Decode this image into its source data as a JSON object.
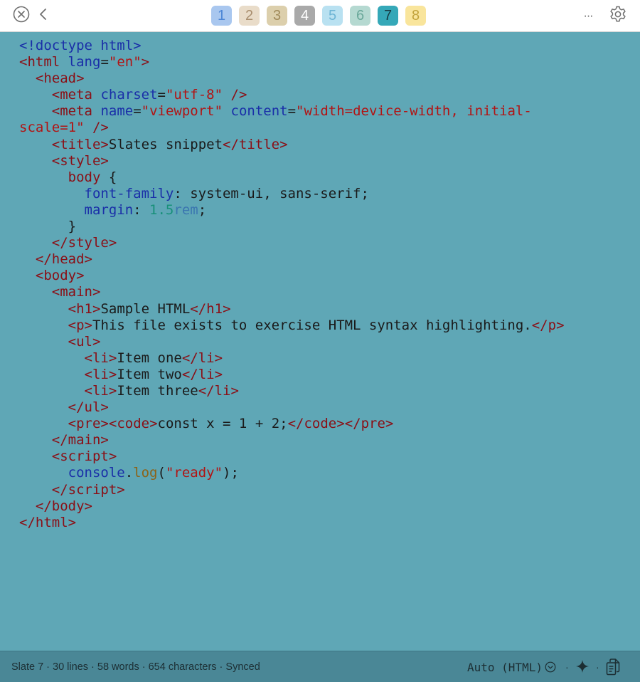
{
  "toolbar": {
    "close_icon": "circle-x-icon",
    "back_icon": "chevron-left-icon",
    "more_label": "···",
    "settings_icon": "gear-icon",
    "tabs": [
      {
        "label": "1",
        "bg": "#a9c7ef",
        "fg": "#4d86d6"
      },
      {
        "label": "2",
        "bg": "#e9dcc9",
        "fg": "#a98e6e"
      },
      {
        "label": "3",
        "bg": "#dccfac",
        "fg": "#a08a5a"
      },
      {
        "label": "4",
        "bg": "#a9a9a9",
        "fg": "#ffffff"
      },
      {
        "label": "5",
        "bg": "#b9e1f1",
        "fg": "#6eb5d5"
      },
      {
        "label": "6",
        "bg": "#b5d9d1",
        "fg": "#6aa89a"
      },
      {
        "label": "7",
        "bg": "#35a8b8",
        "fg": "#173c44"
      },
      {
        "label": "8",
        "bg": "#f9e59c",
        "fg": "#c2a33c"
      }
    ],
    "active_tab": "7"
  },
  "editor": {
    "language": "HTML",
    "lines": [
      [
        {
          "t": "<!doctype html>",
          "c": "dt"
        }
      ],
      [
        {
          "t": "<",
          "c": "tg"
        },
        {
          "t": "html",
          "c": "tg"
        },
        {
          "t": " "
        },
        {
          "t": "lang",
          "c": "at"
        },
        {
          "t": "="
        },
        {
          "t": "\"en\"",
          "c": "st"
        },
        {
          "t": ">",
          "c": "tg"
        }
      ],
      [
        {
          "t": "  "
        },
        {
          "t": "<",
          "c": "tg"
        },
        {
          "t": "head",
          "c": "tg"
        },
        {
          "t": ">",
          "c": "tg"
        }
      ],
      [
        {
          "t": "    "
        },
        {
          "t": "<",
          "c": "tg"
        },
        {
          "t": "meta",
          "c": "tg"
        },
        {
          "t": " "
        },
        {
          "t": "charset",
          "c": "at"
        },
        {
          "t": "="
        },
        {
          "t": "\"utf-8\"",
          "c": "st"
        },
        {
          "t": " "
        },
        {
          "t": "/>",
          "c": "tg"
        }
      ],
      [
        {
          "t": "    "
        },
        {
          "t": "<",
          "c": "tg"
        },
        {
          "t": "meta",
          "c": "tg"
        },
        {
          "t": " "
        },
        {
          "t": "name",
          "c": "at"
        },
        {
          "t": "="
        },
        {
          "t": "\"viewport\"",
          "c": "st"
        },
        {
          "t": " "
        },
        {
          "t": "content",
          "c": "at"
        },
        {
          "t": "="
        },
        {
          "t": "\"width=device-width, initial-",
          "c": "st"
        }
      ],
      [
        {
          "t": "scale=1\"",
          "c": "st"
        },
        {
          "t": " "
        },
        {
          "t": "/>",
          "c": "tg"
        }
      ],
      [
        {
          "t": "    "
        },
        {
          "t": "<",
          "c": "tg"
        },
        {
          "t": "title",
          "c": "tg"
        },
        {
          "t": ">",
          "c": "tg"
        },
        {
          "t": "Slates snippet"
        },
        {
          "t": "</",
          "c": "tg"
        },
        {
          "t": "title",
          "c": "tg"
        },
        {
          "t": ">",
          "c": "tg"
        }
      ],
      [
        {
          "t": "    "
        },
        {
          "t": "<",
          "c": "tg"
        },
        {
          "t": "style",
          "c": "tg"
        },
        {
          "t": ">",
          "c": "tg"
        }
      ],
      [
        {
          "t": "      "
        },
        {
          "t": "body",
          "c": "tg"
        },
        {
          "t": " {"
        }
      ],
      [
        {
          "t": "        "
        },
        {
          "t": "font-family",
          "c": "pr"
        },
        {
          "t": ": system-ui, sans-serif;"
        }
      ],
      [
        {
          "t": "        "
        },
        {
          "t": "margin",
          "c": "pr"
        },
        {
          "t": ": "
        },
        {
          "t": "1.5",
          "c": "nu"
        },
        {
          "t": "rem",
          "c": "un"
        },
        {
          "t": ";"
        }
      ],
      [
        {
          "t": "      }"
        }
      ],
      [
        {
          "t": "    "
        },
        {
          "t": "</",
          "c": "tg"
        },
        {
          "t": "style",
          "c": "tg"
        },
        {
          "t": ">",
          "c": "tg"
        }
      ],
      [
        {
          "t": "  "
        },
        {
          "t": "</",
          "c": "tg"
        },
        {
          "t": "head",
          "c": "tg"
        },
        {
          "t": ">",
          "c": "tg"
        }
      ],
      [
        {
          "t": "  "
        },
        {
          "t": "<",
          "c": "tg"
        },
        {
          "t": "body",
          "c": "tg"
        },
        {
          "t": ">",
          "c": "tg"
        }
      ],
      [
        {
          "t": "    "
        },
        {
          "t": "<",
          "c": "tg"
        },
        {
          "t": "main",
          "c": "tg"
        },
        {
          "t": ">",
          "c": "tg"
        }
      ],
      [
        {
          "t": "      "
        },
        {
          "t": "<",
          "c": "tg"
        },
        {
          "t": "h1",
          "c": "tg"
        },
        {
          "t": ">",
          "c": "tg"
        },
        {
          "t": "Sample HTML"
        },
        {
          "t": "</",
          "c": "tg"
        },
        {
          "t": "h1",
          "c": "tg"
        },
        {
          "t": ">",
          "c": "tg"
        }
      ],
      [
        {
          "t": "      "
        },
        {
          "t": "<",
          "c": "tg"
        },
        {
          "t": "p",
          "c": "tg"
        },
        {
          "t": ">",
          "c": "tg"
        },
        {
          "t": "This file exists to exercise HTML syntax highlighting."
        },
        {
          "t": "</",
          "c": "tg"
        },
        {
          "t": "p",
          "c": "tg"
        },
        {
          "t": ">",
          "c": "tg"
        }
      ],
      [
        {
          "t": "      "
        },
        {
          "t": "<",
          "c": "tg"
        },
        {
          "t": "ul",
          "c": "tg"
        },
        {
          "t": ">",
          "c": "tg"
        }
      ],
      [
        {
          "t": "        "
        },
        {
          "t": "<",
          "c": "tg"
        },
        {
          "t": "li",
          "c": "tg"
        },
        {
          "t": ">",
          "c": "tg"
        },
        {
          "t": "Item one"
        },
        {
          "t": "</",
          "c": "tg"
        },
        {
          "t": "li",
          "c": "tg"
        },
        {
          "t": ">",
          "c": "tg"
        }
      ],
      [
        {
          "t": "        "
        },
        {
          "t": "<",
          "c": "tg"
        },
        {
          "t": "li",
          "c": "tg"
        },
        {
          "t": ">",
          "c": "tg"
        },
        {
          "t": "Item two"
        },
        {
          "t": "</",
          "c": "tg"
        },
        {
          "t": "li",
          "c": "tg"
        },
        {
          "t": ">",
          "c": "tg"
        }
      ],
      [
        {
          "t": "        "
        },
        {
          "t": "<",
          "c": "tg"
        },
        {
          "t": "li",
          "c": "tg"
        },
        {
          "t": ">",
          "c": "tg"
        },
        {
          "t": "Item three"
        },
        {
          "t": "</",
          "c": "tg"
        },
        {
          "t": "li",
          "c": "tg"
        },
        {
          "t": ">",
          "c": "tg"
        }
      ],
      [
        {
          "t": "      "
        },
        {
          "t": "</",
          "c": "tg"
        },
        {
          "t": "ul",
          "c": "tg"
        },
        {
          "t": ">",
          "c": "tg"
        }
      ],
      [
        {
          "t": "      "
        },
        {
          "t": "<",
          "c": "tg"
        },
        {
          "t": "pre",
          "c": "tg"
        },
        {
          "t": ">",
          "c": "tg"
        },
        {
          "t": "<",
          "c": "tg"
        },
        {
          "t": "code",
          "c": "tg"
        },
        {
          "t": ">",
          "c": "tg"
        },
        {
          "t": "const x = 1 + 2;"
        },
        {
          "t": "</",
          "c": "tg"
        },
        {
          "t": "code",
          "c": "tg"
        },
        {
          "t": ">",
          "c": "tg"
        },
        {
          "t": "</",
          "c": "tg"
        },
        {
          "t": "pre",
          "c": "tg"
        },
        {
          "t": ">",
          "c": "tg"
        }
      ],
      [
        {
          "t": "    "
        },
        {
          "t": "</",
          "c": "tg"
        },
        {
          "t": "main",
          "c": "tg"
        },
        {
          "t": ">",
          "c": "tg"
        }
      ],
      [
        {
          "t": "    "
        },
        {
          "t": "<",
          "c": "tg"
        },
        {
          "t": "script",
          "c": "tg"
        },
        {
          "t": ">",
          "c": "tg"
        }
      ],
      [
        {
          "t": "      "
        },
        {
          "t": "console",
          "c": "vr"
        },
        {
          "t": "."
        },
        {
          "t": "log",
          "c": "fn"
        },
        {
          "t": "("
        },
        {
          "t": "\"ready\"",
          "c": "st"
        },
        {
          "t": ");"
        }
      ],
      [
        {
          "t": "    "
        },
        {
          "t": "</",
          "c": "tg"
        },
        {
          "t": "script",
          "c": "tg"
        },
        {
          "t": ">",
          "c": "tg"
        }
      ],
      [
        {
          "t": "  "
        },
        {
          "t": "</",
          "c": "tg"
        },
        {
          "t": "body",
          "c": "tg"
        },
        {
          "t": ">",
          "c": "tg"
        }
      ],
      [
        {
          "t": "</",
          "c": "tg"
        },
        {
          "t": "html",
          "c": "tg"
        },
        {
          "t": ">",
          "c": "tg"
        }
      ]
    ]
  },
  "statusbar": {
    "summary": "Slate 7 · 30 lines · 58 words · 654 characters · Synced",
    "language_mode": "Auto (HTML)",
    "separator": "·",
    "dropdown_icon": "chevron-down-circle-icon",
    "sparkle_icon": "sparkle-icon",
    "copy_icon": "copy-icon"
  },
  "colors": {
    "background": "#5fa7b6",
    "statusbar": "#4a8796",
    "tag": "#8a0f16",
    "attribute": "#1a2fa8",
    "string": "#b11414",
    "number": "#18907a"
  }
}
